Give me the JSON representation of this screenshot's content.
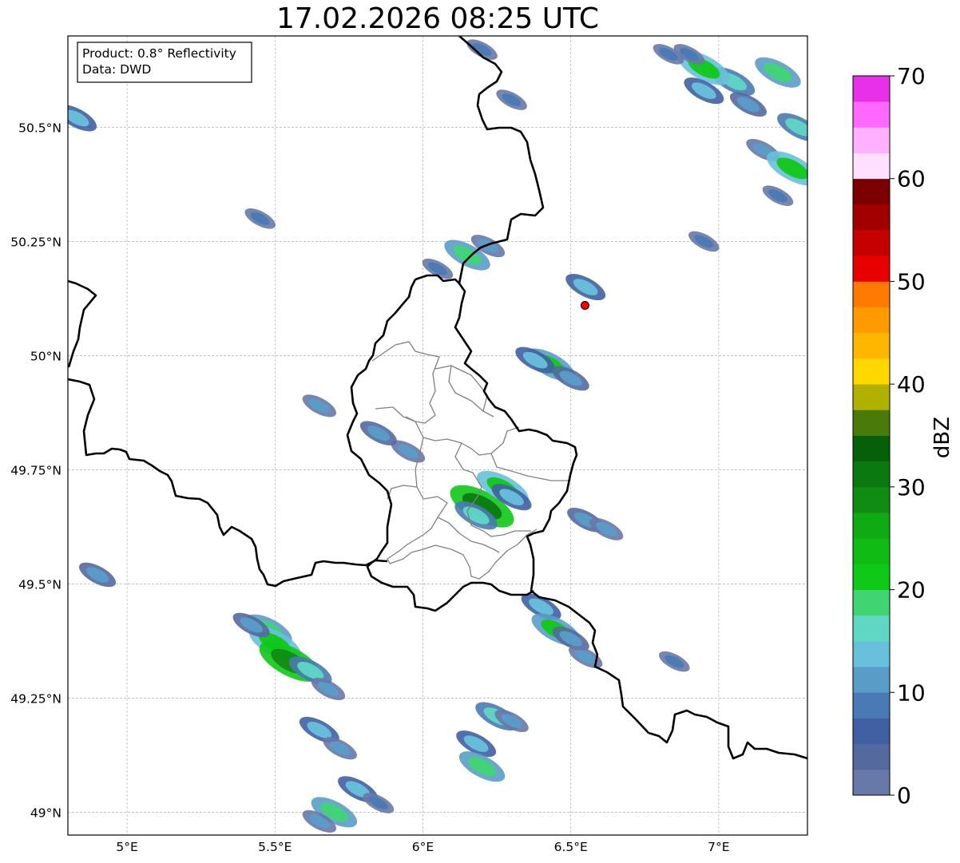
{
  "title": "17.02.2026 08:25 UTC",
  "info_box": {
    "product": "Product: 0.8° Reflectivity",
    "source": "Data: DWD"
  },
  "map": {
    "lon_range": [
      4.8,
      7.3
    ],
    "lat_range": [
      48.95,
      50.7
    ],
    "grid": true,
    "lon_ticks": [
      {
        "value": 5.0,
        "label": "5°E"
      },
      {
        "value": 5.5,
        "label": "5.5°E"
      },
      {
        "value": 6.0,
        "label": "6°E"
      },
      {
        "value": 6.5,
        "label": "6.5°E"
      },
      {
        "value": 7.0,
        "label": "7°E"
      }
    ],
    "lat_ticks": [
      {
        "value": 50.5,
        "label": "50.5°N"
      },
      {
        "value": 50.25,
        "label": "50.25°N"
      },
      {
        "value": 50.0,
        "label": "50°N"
      },
      {
        "value": 49.75,
        "label": "49.75°N"
      },
      {
        "value": 49.5,
        "label": "49.5°N"
      },
      {
        "value": 49.25,
        "label": "49.25°N"
      },
      {
        "value": 49.0,
        "label": "49°N"
      }
    ],
    "radar_site": {
      "lon": 6.548,
      "lat": 50.11,
      "color": "#ff0000"
    },
    "echo_cells": [
      {
        "lon": 7.05,
        "lat": 50.6,
        "dbz": 16
      },
      {
        "lon": 6.95,
        "lat": 50.63,
        "dbz": 22
      },
      {
        "lon": 7.1,
        "lat": 50.55,
        "dbz": 12
      },
      {
        "lon": 6.9,
        "lat": 50.66,
        "dbz": 8
      },
      {
        "lon": 7.2,
        "lat": 50.62,
        "dbz": 18
      },
      {
        "lon": 7.15,
        "lat": 50.45,
        "dbz": 10
      },
      {
        "lon": 7.25,
        "lat": 50.41,
        "dbz": 22
      },
      {
        "lon": 7.2,
        "lat": 50.35,
        "dbz": 8
      },
      {
        "lon": 6.95,
        "lat": 50.58,
        "dbz": 14
      },
      {
        "lon": 7.27,
        "lat": 50.5,
        "dbz": 16
      },
      {
        "lon": 6.83,
        "lat": 50.66,
        "dbz": 8
      },
      {
        "lon": 4.83,
        "lat": 50.52,
        "dbz": 14
      },
      {
        "lon": 5.48,
        "lat": 49.4,
        "dbz": 18
      },
      {
        "lon": 5.5,
        "lat": 49.37,
        "dbz": 22
      },
      {
        "lon": 5.55,
        "lat": 49.33,
        "dbz": 28
      },
      {
        "lon": 5.42,
        "lat": 49.41,
        "dbz": 12
      },
      {
        "lon": 5.62,
        "lat": 49.31,
        "dbz": 16
      },
      {
        "lon": 5.68,
        "lat": 49.27,
        "dbz": 10
      },
      {
        "lon": 5.65,
        "lat": 49.18,
        "dbz": 14
      },
      {
        "lon": 5.72,
        "lat": 49.14,
        "dbz": 10
      },
      {
        "lon": 5.78,
        "lat": 49.05,
        "dbz": 14
      },
      {
        "lon": 5.7,
        "lat": 49.0,
        "dbz": 18
      },
      {
        "lon": 5.65,
        "lat": 48.98,
        "dbz": 10
      },
      {
        "lon": 5.85,
        "lat": 49.02,
        "dbz": 8
      },
      {
        "lon": 6.4,
        "lat": 49.45,
        "dbz": 14
      },
      {
        "lon": 6.45,
        "lat": 49.4,
        "dbz": 20
      },
      {
        "lon": 6.5,
        "lat": 49.38,
        "dbz": 12
      },
      {
        "lon": 6.55,
        "lat": 49.34,
        "dbz": 10
      },
      {
        "lon": 6.2,
        "lat": 49.67,
        "dbz": 30
      },
      {
        "lon": 6.27,
        "lat": 49.71,
        "dbz": 22
      },
      {
        "lon": 6.18,
        "lat": 49.65,
        "dbz": 16
      },
      {
        "lon": 6.3,
        "lat": 49.69,
        "dbz": 14
      },
      {
        "lon": 6.43,
        "lat": 49.98,
        "dbz": 20
      },
      {
        "lon": 6.38,
        "lat": 49.99,
        "dbz": 14
      },
      {
        "lon": 6.5,
        "lat": 49.95,
        "dbz": 12
      },
      {
        "lon": 6.15,
        "lat": 50.22,
        "dbz": 18
      },
      {
        "lon": 6.22,
        "lat": 50.24,
        "dbz": 10
      },
      {
        "lon": 6.05,
        "lat": 50.19,
        "dbz": 8
      },
      {
        "lon": 6.55,
        "lat": 50.15,
        "dbz": 14
      },
      {
        "lon": 6.55,
        "lat": 49.64,
        "dbz": 12
      },
      {
        "lon": 6.62,
        "lat": 49.62,
        "dbz": 10
      },
      {
        "lon": 6.25,
        "lat": 49.21,
        "dbz": 16
      },
      {
        "lon": 6.3,
        "lat": 49.2,
        "dbz": 10
      },
      {
        "lon": 6.18,
        "lat": 49.15,
        "dbz": 14
      },
      {
        "lon": 6.2,
        "lat": 49.1,
        "dbz": 18
      },
      {
        "lon": 5.95,
        "lat": 49.79,
        "dbz": 10
      },
      {
        "lon": 5.65,
        "lat": 49.89,
        "dbz": 10
      },
      {
        "lon": 5.85,
        "lat": 49.83,
        "dbz": 12
      },
      {
        "lon": 5.45,
        "lat": 50.3,
        "dbz": 8
      },
      {
        "lon": 4.9,
        "lat": 49.52,
        "dbz": 12
      },
      {
        "lon": 6.95,
        "lat": 50.25,
        "dbz": 8
      },
      {
        "lon": 6.85,
        "lat": 49.33,
        "dbz": 8
      },
      {
        "lon": 6.3,
        "lat": 50.56,
        "dbz": 8
      },
      {
        "lon": 6.2,
        "lat": 50.67,
        "dbz": 8
      }
    ],
    "labels": {
      "lon_ticks": [
        "5°E",
        "5.5°E",
        "6°E",
        "6.5°E",
        "7°E"
      ]
    }
  },
  "colorbar": {
    "label": "dBZ",
    "range": [
      0,
      70
    ],
    "ticks": [
      {
        "value": 0,
        "label": "0"
      },
      {
        "value": 10,
        "label": "10"
      },
      {
        "value": 20,
        "label": "20"
      },
      {
        "value": 30,
        "label": "30"
      },
      {
        "value": 40,
        "label": "40"
      },
      {
        "value": 50,
        "label": "50"
      },
      {
        "value": 60,
        "label": "60"
      },
      {
        "value": 70,
        "label": "70"
      }
    ],
    "colors": [
      "#6878a8",
      "#54699e",
      "#4160a3",
      "#4a7ab4",
      "#5a9cc8",
      "#68c0dc",
      "#60d6c4",
      "#40d472",
      "#10c818",
      "#10bc14",
      "#10aa14",
      "#108c14",
      "#0a7a10",
      "#06600a",
      "#4a7a0a",
      "#b0b000",
      "#ffd800",
      "#ffb600",
      "#ff9a00",
      "#ff7a00",
      "#e80000",
      "#c60000",
      "#a20000",
      "#7c0000",
      "#ffe0ff",
      "#ffb0ff",
      "#ff68ff",
      "#e830e8"
    ]
  }
}
